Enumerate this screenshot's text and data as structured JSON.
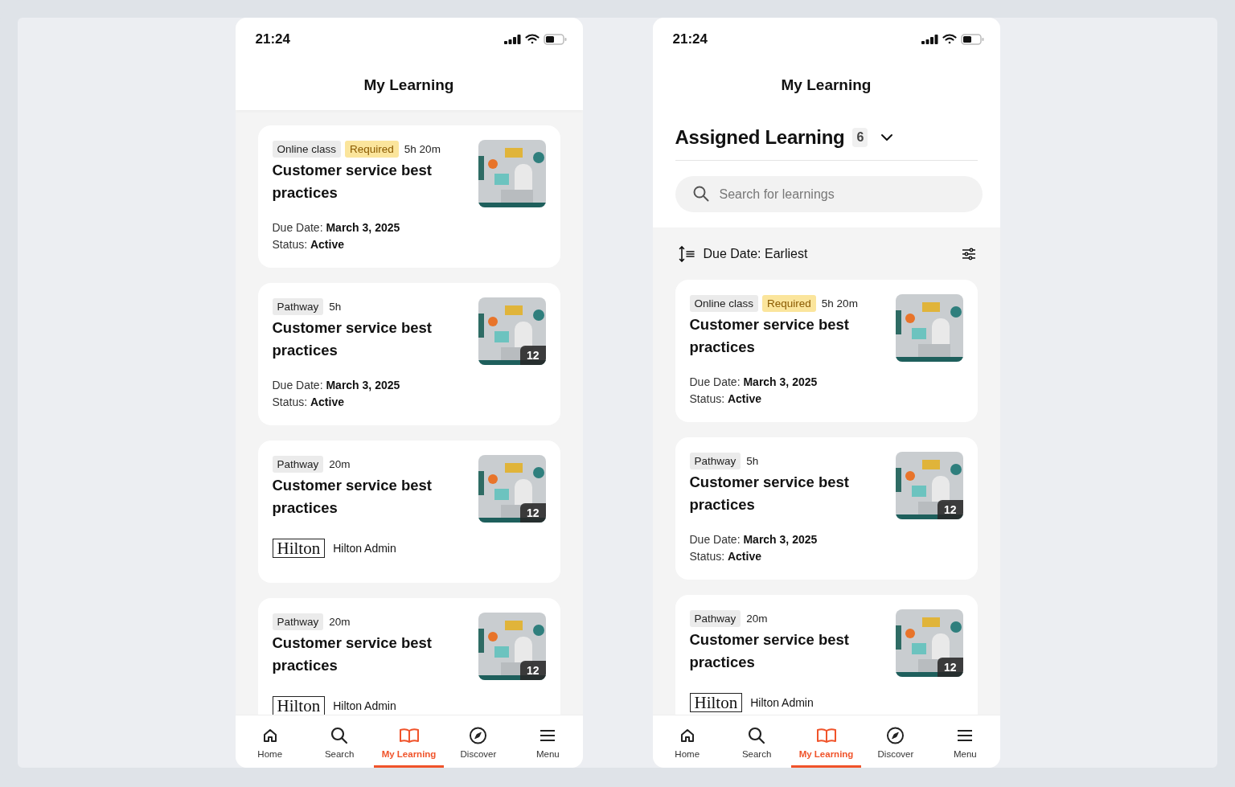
{
  "screens": [
    {
      "status_bar": {
        "time": "21:24"
      },
      "header": {
        "title": "My Learning"
      },
      "cards": [
        {
          "kind": "details",
          "tags": [
            {
              "label": "Online class",
              "kind": "type"
            },
            {
              "label": "Required",
              "kind": "required"
            }
          ],
          "duration": "5h 20m",
          "title": "Customer service best practices",
          "lines": [
            "Due Date: **March 3, 2025**",
            "Status: **Active**"
          ]
        },
        {
          "kind": "details",
          "tags": [
            {
              "label": "Pathway",
              "kind": "type"
            }
          ],
          "duration": "5h",
          "title": "Customer service best practices",
          "count": "12",
          "lines": [
            "Due Date: **March 3, 2025**",
            "Status: **Active**"
          ]
        },
        {
          "kind": "provider",
          "tags": [
            {
              "label": "Pathway",
              "kind": "type"
            }
          ],
          "duration": "20m",
          "title": "Customer service best practices",
          "count": "12",
          "provider": {
            "logo": "Hilton",
            "name": "Hilton Admin"
          }
        },
        {
          "kind": "provider",
          "tags": [
            {
              "label": "Pathway",
              "kind": "type"
            }
          ],
          "duration": "20m",
          "title": "Customer service best practices",
          "count": "12",
          "provider": {
            "logo": "Hilton",
            "name": "Hilton Admin"
          }
        }
      ],
      "tab_bar": [
        {
          "label": "Home",
          "selected": false
        },
        {
          "label": "Search",
          "selected": false
        },
        {
          "label": "My Learning",
          "selected": true
        },
        {
          "label": "Discover",
          "selected": false
        },
        {
          "label": "Menu",
          "selected": false
        }
      ]
    },
    {
      "status_bar": {
        "time": "21:24"
      },
      "header": {
        "title": "My Learning"
      },
      "section": {
        "title": "Assigned Learning",
        "count": "6",
        "search": {
          "placeholder": "Search for learnings"
        },
        "sort": "Due Date: Earliest"
      },
      "cards": [
        {
          "kind": "details",
          "tags": [
            {
              "label": "Online class",
              "kind": "type"
            },
            {
              "label": "Required",
              "kind": "required"
            }
          ],
          "duration": "5h 20m",
          "title": "Customer service best practices",
          "lines": [
            "Due Date: **March 3, 2025**",
            "Status: **Active**"
          ]
        },
        {
          "kind": "details",
          "tags": [
            {
              "label": "Pathway",
              "kind": "type"
            }
          ],
          "duration": "5h",
          "title": "Customer service best practices",
          "count": "12",
          "lines": [
            "Due Date: **March 3, 2025**",
            "Status: **Active**"
          ]
        },
        {
          "kind": "provider",
          "tags": [
            {
              "label": "Pathway",
              "kind": "type"
            }
          ],
          "duration": "20m",
          "title": "Customer service best practices",
          "count": "12",
          "provider": {
            "logo": "Hilton",
            "name": "Hilton Admin"
          }
        }
      ],
      "tab_bar": [
        {
          "label": "Home",
          "selected": false
        },
        {
          "label": "Search",
          "selected": false
        },
        {
          "label": "My Learning",
          "selected": true
        },
        {
          "label": "Discover",
          "selected": false
        },
        {
          "label": "Menu",
          "selected": false
        }
      ]
    }
  ]
}
